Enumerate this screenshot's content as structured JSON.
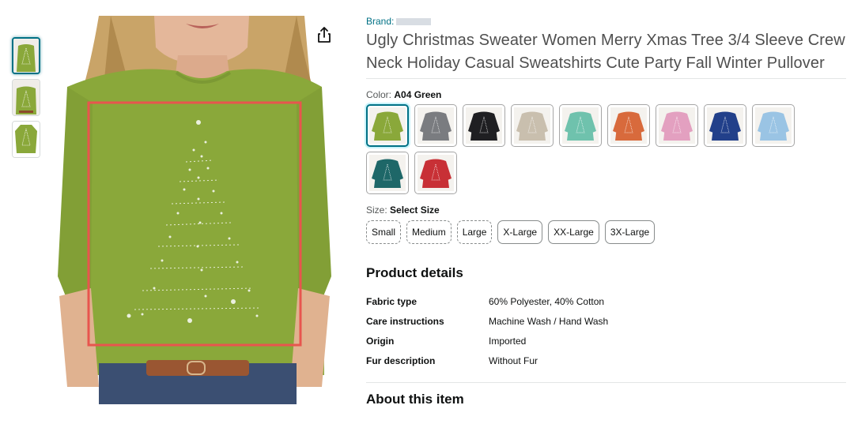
{
  "brand": {
    "label": "Brand:"
  },
  "product": {
    "title": "Ugly Christmas Sweater Women Merry Xmas Tree 3/4 Sleeve Crew Neck Holiday Casual Sweatshirts Cute Party Fall Winter Pullover"
  },
  "color": {
    "label": "Color:",
    "selected": "A04 Green",
    "swatches": [
      {
        "name": "green",
        "hex": "#8aa83a",
        "selected": true
      },
      {
        "name": "gray",
        "hex": "#7a7c80"
      },
      {
        "name": "black",
        "hex": "#1f1f22"
      },
      {
        "name": "beige",
        "hex": "#c9bfae"
      },
      {
        "name": "mint",
        "hex": "#6fc2ad"
      },
      {
        "name": "orange",
        "hex": "#d86a3c"
      },
      {
        "name": "pink",
        "hex": "#e3a0c0"
      },
      {
        "name": "navy",
        "hex": "#22408a"
      },
      {
        "name": "light-blue",
        "hex": "#9ac4e4"
      },
      {
        "name": "teal",
        "hex": "#1e6768"
      },
      {
        "name": "red",
        "hex": "#c83036"
      }
    ]
  },
  "size": {
    "label": "Size:",
    "selected": "Select Size",
    "options": [
      "Small",
      "Medium",
      "Large",
      "X-Large",
      "XX-Large",
      "3X-Large"
    ]
  },
  "details": {
    "heading": "Product details",
    "rows": [
      {
        "key": "Fabric type",
        "value": "60% Polyester, 40% Cotton"
      },
      {
        "key": "Care instructions",
        "value": "Machine Wash / Hand Wash"
      },
      {
        "key": "Origin",
        "value": "Imported"
      },
      {
        "key": "Fur description",
        "value": "Without Fur"
      }
    ]
  },
  "about": {
    "heading": "About this item"
  },
  "colors": {
    "accent": "#007185",
    "highlight": "#e8554e",
    "shirt": "#8aa83a"
  }
}
